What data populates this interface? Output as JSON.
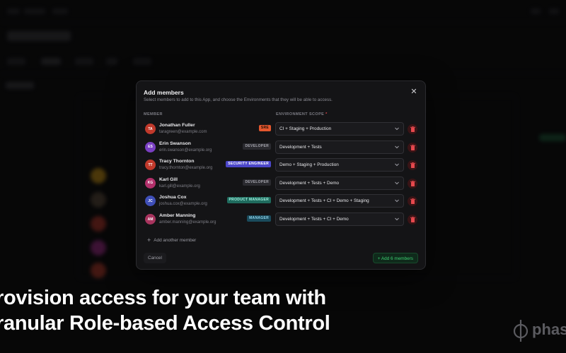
{
  "modal": {
    "title": "Add members",
    "subtitle": "Select members to add to this App, and choose the Environments that they will be able to access.",
    "close_icon": "close-icon",
    "col_member": "MEMBER",
    "col_scope": "ENVIRONMENT SCOPE",
    "col_scope_required": "*",
    "members": [
      {
        "initials": "TA",
        "name": "Jonathan Fuller",
        "email": "taragreen@example.com",
        "role": "SRE",
        "scope": "CI + Staging + Production",
        "avatar_color": "#c0392b",
        "badge_bg": "#e4572e",
        "badge_fg": "#1a0b05"
      },
      {
        "initials": "ES",
        "name": "Erin Swanson",
        "email": "erin.swanson@example.org",
        "role": "DEVELOPER",
        "scope": "Development + Tests",
        "avatar_color": "#7a3fc2",
        "badge_bg": "#2a2a2f",
        "badge_fg": "#a6a6ae"
      },
      {
        "initials": "TT",
        "name": "Tracy Thornton",
        "email": "tracy.thornton@example.org",
        "role": "SECURITY ENGINEER",
        "scope": "Demo + Staging + Production",
        "avatar_color": "#c0392b",
        "badge_bg": "#4b46c9",
        "badge_fg": "#ffffff"
      },
      {
        "initials": "KG",
        "name": "Karl Gill",
        "email": "karl.gill@example.org",
        "role": "DEVELOPER",
        "scope": "Development + Tests + Demo",
        "avatar_color": "#b3306b",
        "badge_bg": "#2a2a2f",
        "badge_fg": "#a6a6ae"
      },
      {
        "initials": "JC",
        "name": "Joshua Cox",
        "email": "joshua.cox@example.org",
        "role": "PRODUCT MANAGER",
        "scope": "Development + Tests + CI + Demo + Staging",
        "avatar_color": "#3f4fb8",
        "badge_bg": "#1f6b5e",
        "badge_fg": "#9ff0de"
      },
      {
        "initials": "AM",
        "name": "Amber Manning",
        "email": "amber.manning@example.org",
        "role": "MANAGER",
        "scope": "Development + Tests + CI + Demo",
        "avatar_color": "#a8345e",
        "badge_bg": "#1a4b5c",
        "badge_fg": "#8fd3ea"
      }
    ],
    "add_another": "Add another member",
    "cancel": "Cancel",
    "submit": "Add 6 members"
  },
  "headline": {
    "line1": "rovision access for your team with",
    "line2": "ranular Role-based Access Control"
  },
  "logo": {
    "text": "phas"
  }
}
